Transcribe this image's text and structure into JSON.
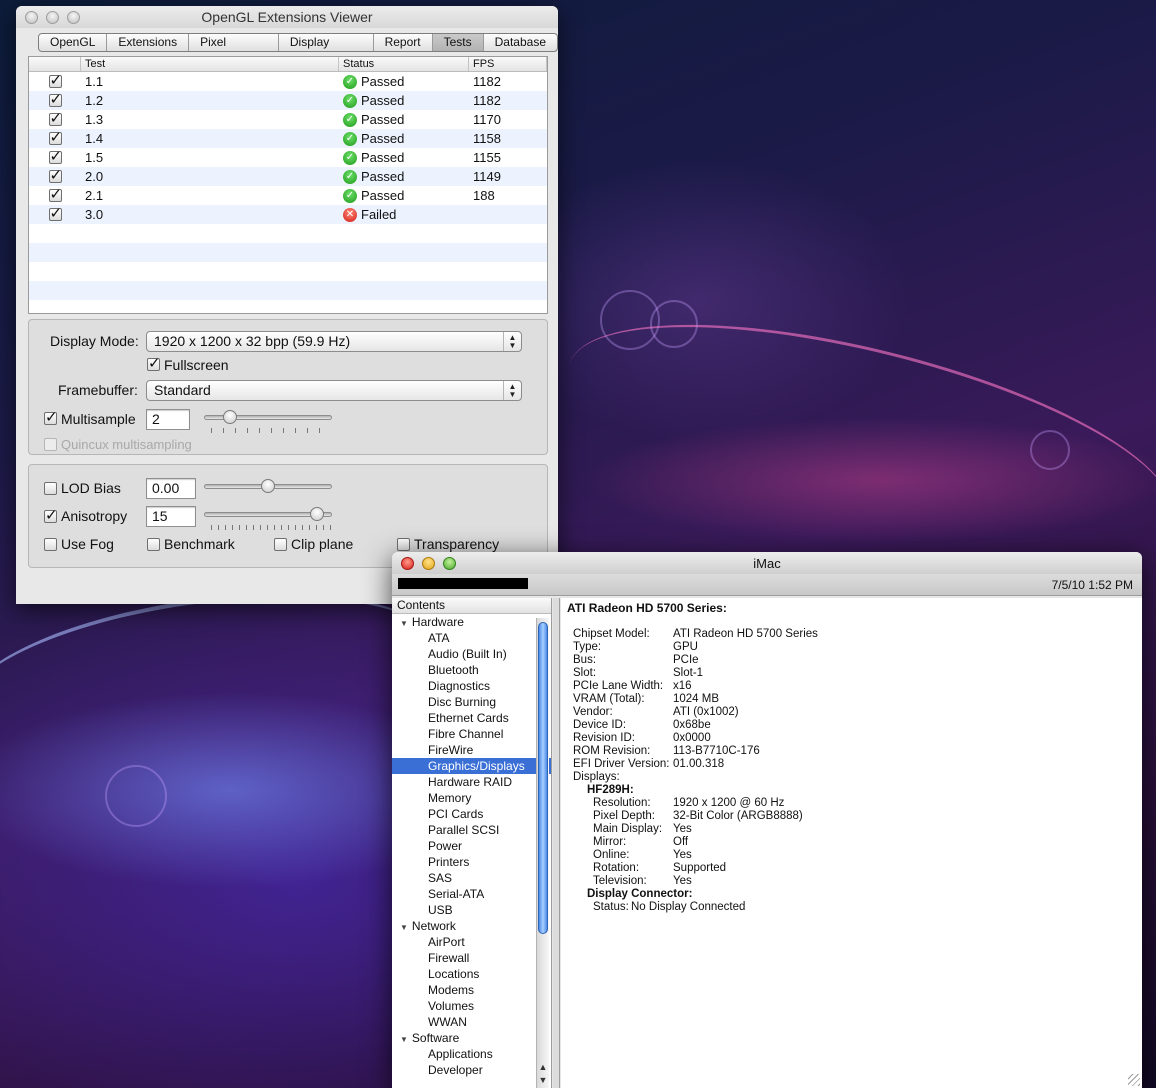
{
  "opengl_window": {
    "title": "OpenGL Extensions Viewer",
    "tabs": [
      "OpenGL",
      "Extensions",
      "Pixel Formats",
      "Display Modes",
      "Report",
      "Tests",
      "Database"
    ],
    "selected_tab": "Tests",
    "table": {
      "headers": {
        "test": "Test",
        "status": "Status",
        "fps": "FPS"
      },
      "rows": [
        {
          "checked": true,
          "test": "1.1",
          "status": "Passed",
          "ok": true,
          "fps": "1182"
        },
        {
          "checked": true,
          "test": "1.2",
          "status": "Passed",
          "ok": true,
          "fps": "1182"
        },
        {
          "checked": true,
          "test": "1.3",
          "status": "Passed",
          "ok": true,
          "fps": "1170"
        },
        {
          "checked": true,
          "test": "1.4",
          "status": "Passed",
          "ok": true,
          "fps": "1158"
        },
        {
          "checked": true,
          "test": "1.5",
          "status": "Passed",
          "ok": true,
          "fps": "1155"
        },
        {
          "checked": true,
          "test": "2.0",
          "status": "Passed",
          "ok": true,
          "fps": "1149"
        },
        {
          "checked": true,
          "test": "2.1",
          "status": "Passed",
          "ok": true,
          "fps": "188"
        },
        {
          "checked": true,
          "test": "3.0",
          "status": "Failed",
          "ok": false,
          "fps": ""
        }
      ]
    },
    "display_mode": {
      "label": "Display Mode:",
      "value": "1920 x 1200 x 32 bpp (59.9 Hz)"
    },
    "fullscreen": {
      "label": "Fullscreen",
      "checked": true
    },
    "framebuffer": {
      "label": "Framebuffer:",
      "value": "Standard"
    },
    "multisample": {
      "label": "Multisample",
      "checked": true,
      "value": "2",
      "slider_fraction": 0.17
    },
    "quincunx": {
      "label": "Quincux multisampling",
      "checked": false,
      "enabled": false
    },
    "lod_bias": {
      "label": "LOD Bias",
      "checked": false,
      "value": "0.00",
      "slider_fraction": 0.5
    },
    "anisotropy": {
      "label": "Anisotropy",
      "checked": true,
      "value": "15",
      "slider_fraction": 0.93
    },
    "options": {
      "use_fog": {
        "label": "Use Fog",
        "checked": false
      },
      "benchmark": {
        "label": "Benchmark",
        "checked": false
      },
      "clip_plane": {
        "label": "Clip plane",
        "checked": false
      },
      "transparency": {
        "label": "Transparency",
        "checked": false
      }
    }
  },
  "imac_window": {
    "title": "iMac",
    "datetime": "7/5/10 1:52 PM",
    "contents_header": "Contents",
    "tree": [
      {
        "label": "Hardware",
        "group": true
      },
      {
        "label": "ATA"
      },
      {
        "label": "Audio (Built In)"
      },
      {
        "label": "Bluetooth"
      },
      {
        "label": "Diagnostics"
      },
      {
        "label": "Disc Burning"
      },
      {
        "label": "Ethernet Cards"
      },
      {
        "label": "Fibre Channel"
      },
      {
        "label": "FireWire"
      },
      {
        "label": "Graphics/Displays",
        "selected": true
      },
      {
        "label": "Hardware RAID"
      },
      {
        "label": "Memory"
      },
      {
        "label": "PCI Cards"
      },
      {
        "label": "Parallel SCSI"
      },
      {
        "label": "Power"
      },
      {
        "label": "Printers"
      },
      {
        "label": "SAS"
      },
      {
        "label": "Serial-ATA"
      },
      {
        "label": "USB"
      },
      {
        "label": "Network",
        "group": true
      },
      {
        "label": "AirPort"
      },
      {
        "label": "Firewall"
      },
      {
        "label": "Locations"
      },
      {
        "label": "Modems"
      },
      {
        "label": "Volumes"
      },
      {
        "label": "WWAN"
      },
      {
        "label": "Software",
        "group": true
      },
      {
        "label": "Applications"
      },
      {
        "label": "Developer"
      }
    ],
    "detail": {
      "title": "ATI Radeon HD 5700 Series:",
      "fields": [
        {
          "k": "Chipset Model:",
          "v": "ATI Radeon HD 5700 Series"
        },
        {
          "k": "Type:",
          "v": "GPU"
        },
        {
          "k": "Bus:",
          "v": "PCIe"
        },
        {
          "k": "Slot:",
          "v": "Slot-1"
        },
        {
          "k": "PCIe Lane Width:",
          "v": "x16"
        },
        {
          "k": "VRAM (Total):",
          "v": "1024 MB"
        },
        {
          "k": "Vendor:",
          "v": "ATI (0x1002)"
        },
        {
          "k": "Device ID:",
          "v": "0x68be"
        },
        {
          "k": "Revision ID:",
          "v": "0x0000"
        },
        {
          "k": "ROM Revision:",
          "v": "113-B7710C-176"
        },
        {
          "k": "EFI Driver Version:",
          "v": "01.00.318"
        },
        {
          "k": "Displays:",
          "v": ""
        }
      ],
      "display_name": "HF289H:",
      "display_fields": [
        {
          "k": "Resolution:",
          "v": "1920 x 1200 @ 60 Hz"
        },
        {
          "k": "Pixel Depth:",
          "v": "32-Bit Color (ARGB8888)"
        },
        {
          "k": "Main Display:",
          "v": "Yes"
        },
        {
          "k": "Mirror:",
          "v": "Off"
        },
        {
          "k": "Online:",
          "v": "Yes"
        },
        {
          "k": "Rotation:",
          "v": "Supported"
        },
        {
          "k": "Television:",
          "v": "Yes"
        }
      ],
      "connector_name": "Display Connector:",
      "connector_fields": [
        {
          "k": "Status:",
          "v": "No Display Connected"
        }
      ]
    }
  }
}
